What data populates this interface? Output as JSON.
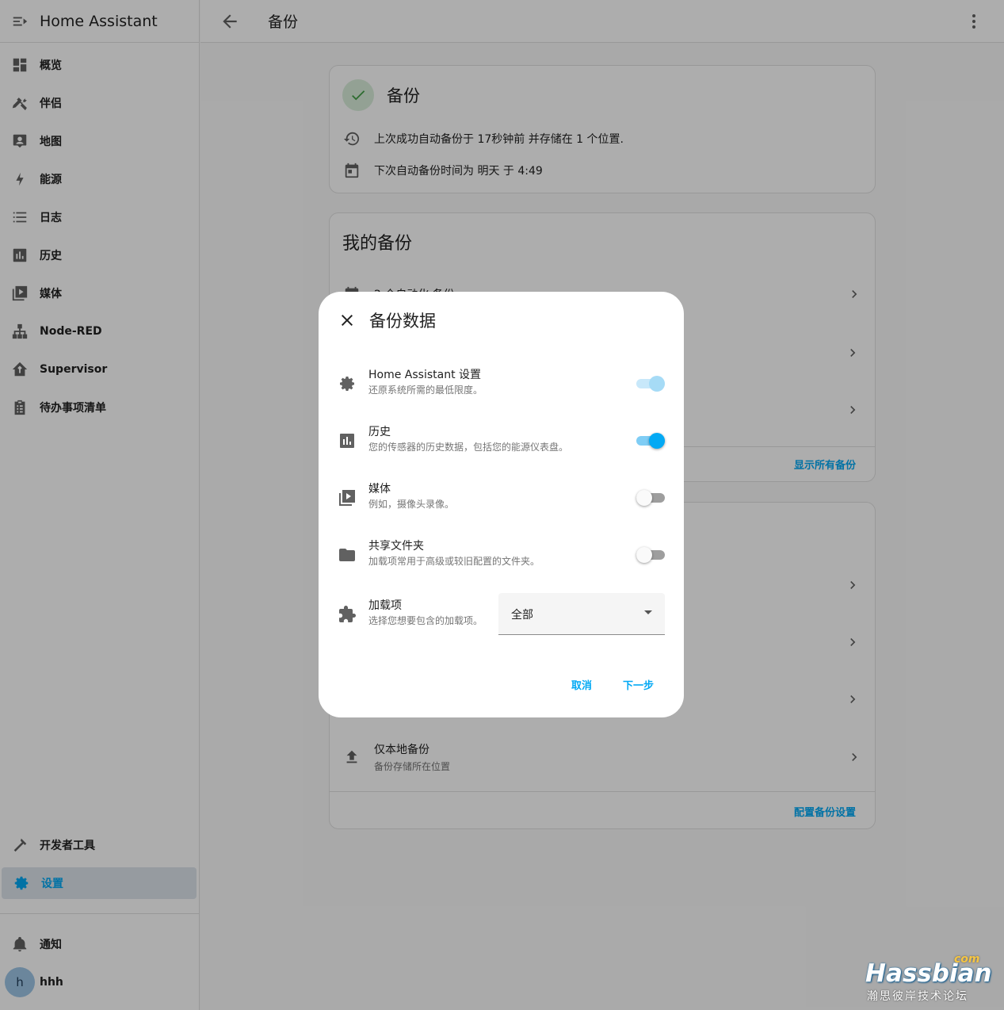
{
  "app": {
    "title": "Home Assistant"
  },
  "sidebar": {
    "items": [
      {
        "label": "概览",
        "icon": "dashboard-icon"
      },
      {
        "label": "伴侣",
        "icon": "tools-icon"
      },
      {
        "label": "地图",
        "icon": "map-icon"
      },
      {
        "label": "能源",
        "icon": "lightning-icon"
      },
      {
        "label": "日志",
        "icon": "list-icon"
      },
      {
        "label": "历史",
        "icon": "chart-icon"
      },
      {
        "label": "媒体",
        "icon": "media-icon"
      },
      {
        "label": "Node-RED",
        "icon": "sitemap-icon"
      },
      {
        "label": "Supervisor",
        "icon": "home-assistant-icon"
      },
      {
        "label": "待办事项清单",
        "icon": "clipboard-list-icon"
      }
    ],
    "developer_tools": "开发者工具",
    "settings": "设置",
    "notifications": "通知",
    "user": {
      "initial": "h",
      "name": "hhh"
    }
  },
  "topbar": {
    "title": "备份"
  },
  "status_card": {
    "title": "备份",
    "last_backup": "上次成功自动备份于 17秒钟前 并存储在 1 个位置.",
    "next_backup": "下次自动备份时间为 明天 于 4:49"
  },
  "my_backups": {
    "title": "我的备份",
    "row1": "2 个自动化 备份",
    "show_all": "显示所有备份"
  },
  "locations": {
    "local_title": "仅本地备份",
    "local_sub": "备份存储所在位置",
    "configure": "配置备份设置"
  },
  "dialog": {
    "title": "备份数据",
    "options": [
      {
        "title": "Home Assistant 设置",
        "sub": "还原系统所需的最低限度。",
        "state": "on-disabled"
      },
      {
        "title": "历史",
        "sub": "您的传感器的历史数据，包括您的能源仪表盘。",
        "state": "on"
      },
      {
        "title": "媒体",
        "sub": "例如，摄像头录像。",
        "state": "off"
      },
      {
        "title": "共享文件夹",
        "sub": "加载项常用于高级或较旧配置的文件夹。",
        "state": "off"
      }
    ],
    "addons": {
      "title": "加载项",
      "sub": "选择您想要包含的加载项。",
      "selected": "全部"
    },
    "cancel": "取消",
    "next": "下一步"
  },
  "watermark": {
    "logo": "Hassbian",
    "com": "com",
    "sub": "瀚思彼岸技术论坛"
  },
  "colors": {
    "accent": "#03a9f4",
    "success": "#43a047"
  }
}
